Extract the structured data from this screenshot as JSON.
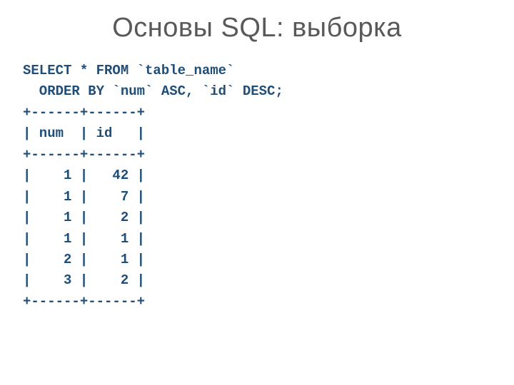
{
  "title": "Основы SQL: выборка",
  "code": {
    "line1": "SELECT * FROM `table_name`",
    "line2": "  ORDER BY `num` ASC, `id` DESC;",
    "border": "+------+------+",
    "header": "| num  | id   |",
    "rows": [
      "|    1 |   42 |",
      "|    1 |    7 |",
      "|    1 |    2 |",
      "|    1 |    1 |",
      "|    2 |    1 |",
      "|    3 |    2 |"
    ]
  },
  "chart_data": {
    "type": "table",
    "title": "SQL SELECT result ordered by num ASC, id DESC",
    "columns": [
      "num",
      "id"
    ],
    "rows": [
      [
        1,
        42
      ],
      [
        1,
        7
      ],
      [
        1,
        2
      ],
      [
        1,
        1
      ],
      [
        2,
        1
      ],
      [
        3,
        2
      ]
    ]
  }
}
